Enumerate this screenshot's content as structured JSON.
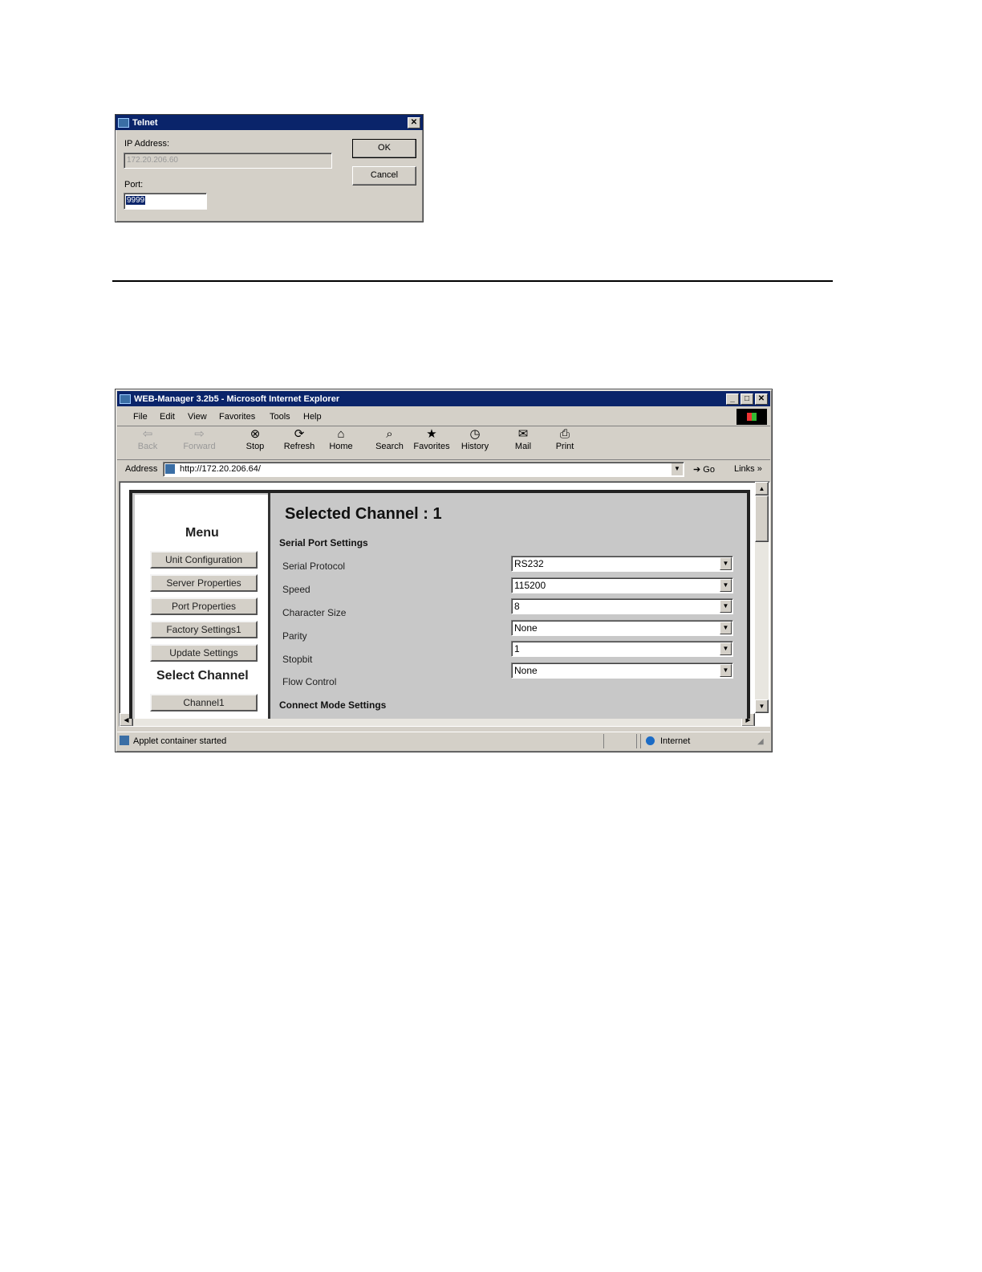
{
  "telnet": {
    "title": "Telnet",
    "close": "✕",
    "ip_label": "IP Address:",
    "ip_value": "172.20.206.60",
    "port_label": "Port:",
    "port_value": "9999",
    "ok": "OK",
    "cancel": "Cancel"
  },
  "browser": {
    "title": "WEB-Manager 3.2b5 - Microsoft Internet Explorer",
    "menu": [
      "File",
      "Edit",
      "View",
      "Favorites",
      "Tools",
      "Help"
    ],
    "toolbar": {
      "back": "Back",
      "forward": "Forward",
      "stop": "Stop",
      "refresh": "Refresh",
      "home": "Home",
      "search": "Search",
      "favorites": "Favorites",
      "history": "History",
      "mail": "Mail",
      "print": "Print"
    },
    "address_label": "Address",
    "url": "http://172.20.206.64/",
    "go": "Go",
    "links": "Links",
    "status": "Applet container started",
    "zone": "Internet"
  },
  "page": {
    "heading": "Selected Channel : 1",
    "menu_title": "Menu",
    "menu_buttons": [
      "Unit Configuration",
      "Server Properties",
      "Port Properties",
      "Factory Settings1",
      "Update Settings"
    ],
    "select_channel": "Select Channel",
    "channel_button": "Channel1",
    "serial_section": "Serial Port Settings",
    "connect_section": "Connect Mode Settings",
    "fields": [
      {
        "label": "Serial Protocol",
        "value": "RS232"
      },
      {
        "label": "Speed",
        "value": "115200"
      },
      {
        "label": "Character Size",
        "value": "8"
      },
      {
        "label": "Parity",
        "value": "None"
      },
      {
        "label": "Stopbit",
        "value": "1"
      },
      {
        "label": "Flow Control",
        "value": "None"
      }
    ]
  }
}
